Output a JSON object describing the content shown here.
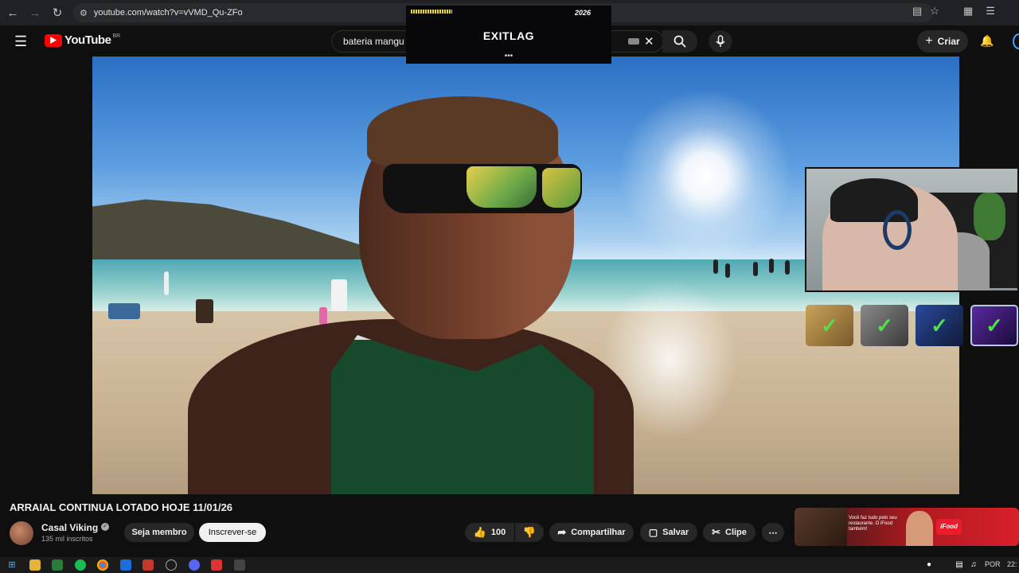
{
  "browser": {
    "url": "youtube.com/watch?v=vVMD_Qu-ZFo"
  },
  "youtube": {
    "logo_text": "YouTube",
    "country": "BR",
    "search_query": "bateria mangu",
    "create_label": "Criar"
  },
  "ad_overlay": {
    "brand": "EXITLAG",
    "year": "2026",
    "more": "•••"
  },
  "video": {
    "title": "ARRAIAL CONTINUA LOTADO HOJE 11/01/26"
  },
  "channel": {
    "name": "Casal Viking",
    "subscribers": "135 mil inscritos"
  },
  "actions": {
    "join_label": "Seja membro",
    "subscribe_label": "Inscrever-se",
    "like_count": "100",
    "share_label": "Compartilhar",
    "save_label": "Salvar",
    "clip_label": "Clipe"
  },
  "ifood_ad": {
    "text": "Você faz tudo pelo seu restaurante. O iFood também!",
    "logo": "iFood"
  },
  "taskbar": {
    "language": "POR",
    "clock": "22:"
  },
  "colors": {
    "youtube_red": "#ff0000",
    "background": "#0f0f0f",
    "pill": "#272727",
    "achievement_check": "#4ee34e"
  }
}
